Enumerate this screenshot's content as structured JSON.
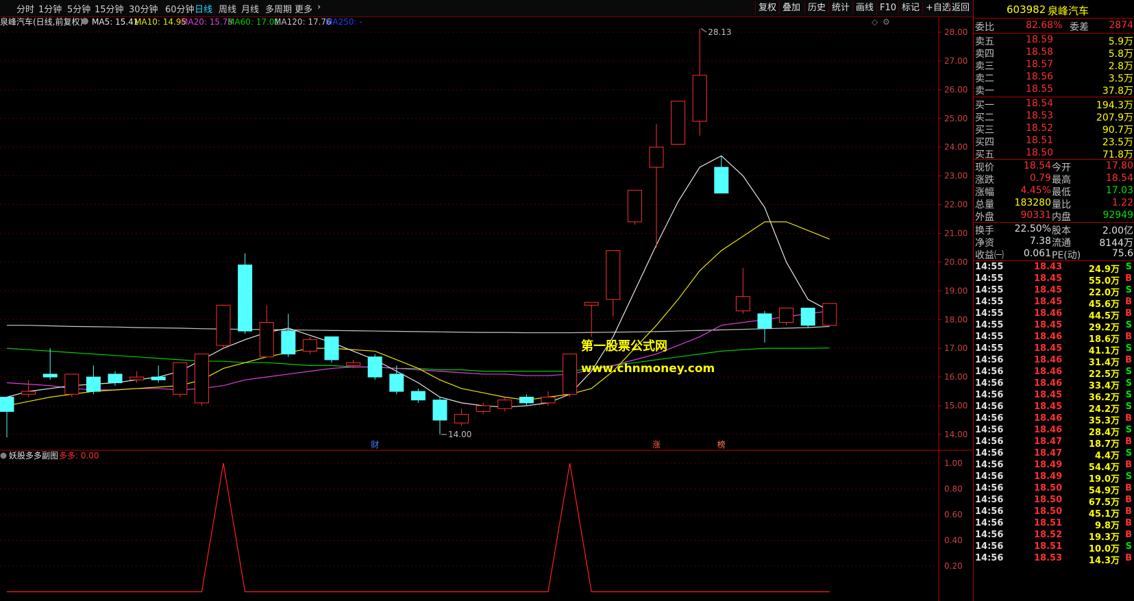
{
  "toolbar": {
    "period_tabs": [
      "分时",
      "1分钟",
      "5分钟",
      "15分钟",
      "30分钟",
      "60分钟",
      "日线",
      "周线",
      "月线",
      "多周期",
      "更多"
    ],
    "active_tab": "日线",
    "right_buttons": [
      "复权",
      "叠加",
      "历史",
      "统计",
      "画线",
      "F10",
      "标记",
      "+自选",
      "返回"
    ]
  },
  "main_chart": {
    "legend_title": "泉峰汽车(日线,前复权)",
    "ma_legend": [
      {
        "label": "MA5: 15.41",
        "color": "#e8e8e8"
      },
      {
        "label": "MA10: 14.95",
        "color": "#e8e800"
      },
      {
        "label": "MA20: 15.78",
        "color": "#e040e0"
      },
      {
        "label": "MA60: 17.01",
        "color": "#00d000"
      },
      {
        "label": "MA120: 17.76",
        "color": "#c8c8c8"
      },
      {
        "label": "MA250: -",
        "color": "#2040ff"
      }
    ],
    "price_ticks": [
      "28.00",
      "27.00",
      "26.00",
      "25.00",
      "24.00",
      "23.00",
      "22.00",
      "21.00",
      "20.00",
      "19.00",
      "18.00",
      "17.00",
      "16.00",
      "15.00",
      "14.00"
    ],
    "high_label": "28.13",
    "low_label": "14.00",
    "markers": [
      "财",
      "涨",
      "榜"
    ],
    "watermark": {
      "title": "第一股票公式网",
      "url": "www.chnmoney.com"
    }
  },
  "chart_data": [
    {
      "type": "candlestick",
      "y_range": [
        14.0,
        28.0
      ],
      "candles": [
        [
          15.3,
          14.8,
          15.2,
          13.9
        ],
        [
          15.4,
          15.5,
          15.9,
          15.3
        ],
        [
          16.1,
          16.0,
          17.0,
          15.9
        ],
        [
          15.4,
          16.1,
          16.1,
          15.3
        ],
        [
          16.0,
          15.5,
          16.4,
          15.4
        ],
        [
          16.1,
          15.8,
          16.2,
          15.7
        ],
        [
          15.9,
          16.0,
          16.2,
          15.8
        ],
        [
          16.0,
          15.9,
          16.4,
          15.8
        ],
        [
          15.4,
          16.5,
          16.5,
          15.3
        ],
        [
          15.1,
          16.8,
          16.8,
          15.0
        ],
        [
          17.1,
          18.5,
          18.5,
          17.0
        ],
        [
          19.9,
          17.6,
          20.3,
          17.5
        ],
        [
          16.7,
          17.9,
          18.5,
          16.7
        ],
        [
          17.6,
          16.8,
          18.2,
          16.7
        ],
        [
          16.9,
          17.3,
          17.4,
          16.8
        ],
        [
          17.4,
          16.6,
          17.4,
          16.5
        ],
        [
          16.4,
          16.5,
          16.6,
          16.3
        ],
        [
          16.7,
          16.0,
          16.8,
          15.9
        ],
        [
          16.1,
          15.5,
          16.4,
          15.4
        ],
        [
          15.5,
          15.2,
          15.6,
          15.1
        ],
        [
          15.2,
          14.5,
          15.3,
          14.0
        ],
        [
          14.4,
          14.7,
          14.9,
          14.3
        ],
        [
          14.8,
          15.0,
          15.1,
          14.7
        ],
        [
          14.9,
          15.2,
          15.3,
          14.8
        ],
        [
          15.3,
          15.1,
          15.4,
          15.0
        ],
        [
          15.1,
          15.3,
          15.5,
          15.0
        ],
        [
          15.4,
          16.8,
          16.8,
          15.3
        ],
        [
          18.5,
          18.6,
          18.6,
          17.4
        ],
        [
          18.7,
          20.4,
          20.4,
          18.1
        ],
        [
          21.4,
          22.5,
          22.5,
          21.3
        ],
        [
          23.3,
          24.0,
          24.8,
          20.5
        ],
        [
          24.1,
          25.6,
          25.6,
          24.1
        ],
        [
          24.9,
          26.5,
          28.13,
          24.4
        ],
        [
          23.3,
          22.4,
          23.7,
          22.4
        ],
        [
          18.3,
          18.8,
          19.8,
          18.2
        ],
        [
          18.2,
          17.7,
          18.3,
          17.2
        ],
        [
          17.9,
          18.4,
          18.4,
          17.8
        ],
        [
          18.4,
          17.8,
          18.4,
          17.7
        ],
        [
          17.8,
          18.56,
          18.56,
          17.8
        ]
      ],
      "ma5": [
        15.3,
        15.5,
        15.6,
        15.7,
        15.75,
        15.8,
        15.9,
        16.0,
        16.2,
        16.6,
        17.0,
        17.3,
        17.55,
        17.7,
        17.45,
        17.2,
        16.9,
        16.6,
        16.2,
        15.8,
        15.3,
        15.1,
        15.0,
        14.95,
        15.0,
        15.1,
        15.4,
        16.2,
        17.4,
        19.0,
        20.6,
        22.1,
        23.3,
        23.7,
        23.0,
        21.9,
        20.0,
        18.7,
        18.3
      ],
      "ma10": [
        15.0,
        15.15,
        15.3,
        15.4,
        15.5,
        15.55,
        15.6,
        15.65,
        15.7,
        15.9,
        16.3,
        16.5,
        16.7,
        16.85,
        17.0,
        17.0,
        16.95,
        16.9,
        16.6,
        16.3,
        15.9,
        15.6,
        15.45,
        15.3,
        15.2,
        15.3,
        15.4,
        15.6,
        16.2,
        17.0,
        17.8,
        18.7,
        19.7,
        20.4,
        20.9,
        21.4,
        21.4,
        21.1,
        20.8
      ],
      "ma20": [
        15.8,
        15.75,
        15.7,
        15.6,
        15.55,
        15.55,
        15.6,
        15.6,
        15.55,
        15.6,
        15.7,
        15.9,
        16.0,
        16.1,
        16.2,
        16.3,
        16.35,
        16.35,
        16.3,
        16.25,
        16.2,
        16.15,
        16.1,
        16.1,
        16.05,
        16.05,
        16.1,
        16.25,
        16.4,
        16.6,
        16.8,
        17.1,
        17.4,
        17.8,
        17.9,
        18.0,
        18.1,
        18.2,
        18.3
      ],
      "ma60": [
        17.0,
        16.95,
        16.9,
        16.85,
        16.8,
        16.75,
        16.7,
        16.65,
        16.6,
        16.55,
        16.55,
        16.5,
        16.5,
        16.45,
        16.4,
        16.4,
        16.35,
        16.35,
        16.3,
        16.3,
        16.25,
        16.25,
        16.2,
        16.2,
        16.2,
        16.2,
        16.2,
        16.3,
        16.4,
        16.5,
        16.6,
        16.7,
        16.8,
        16.9,
        16.95,
        17.0,
        17.0,
        17.0,
        17.01
      ],
      "ma120": [
        17.8,
        17.8,
        17.78,
        17.76,
        17.75,
        17.74,
        17.72,
        17.71,
        17.7,
        17.68,
        17.67,
        17.66,
        17.65,
        17.64,
        17.63,
        17.62,
        17.61,
        17.6,
        17.59,
        17.58,
        17.57,
        17.56,
        17.55,
        17.55,
        17.54,
        17.54,
        17.54,
        17.55,
        17.56,
        17.57,
        17.58,
        17.6,
        17.62,
        17.64,
        17.66,
        17.68,
        17.7,
        17.72,
        17.76
      ]
    },
    {
      "type": "line",
      "title": "妖股多多副图",
      "series_label": "多多: 0.00",
      "y_ticks": [
        "1.00",
        "0.80",
        "0.60",
        "0.40",
        "0.20"
      ],
      "y_range": [
        0.2,
        1.0
      ],
      "values": [
        0,
        0,
        0,
        0,
        0,
        0,
        0,
        0,
        0,
        0,
        1,
        0,
        0,
        0,
        0,
        0,
        0,
        0,
        0,
        0,
        0,
        0,
        0,
        0,
        0,
        0,
        1,
        0,
        0,
        0,
        0,
        0,
        0,
        0,
        0,
        0,
        0,
        0,
        0
      ]
    }
  ],
  "quote": {
    "code": "603982",
    "name": "泉峰汽车",
    "weibi_label": "委比",
    "weibi_value": "82.68%",
    "weicha_label": "委差",
    "weicha_value": "2874",
    "sell": [
      {
        "label": "卖五",
        "price": "18.59",
        "vol": "5.9万"
      },
      {
        "label": "卖四",
        "price": "18.58",
        "vol": "5.8万"
      },
      {
        "label": "卖三",
        "price": "18.57",
        "vol": "2.8万"
      },
      {
        "label": "卖二",
        "price": "18.56",
        "vol": "3.5万"
      },
      {
        "label": "卖一",
        "price": "18.55",
        "vol": "37.8万"
      }
    ],
    "buy": [
      {
        "label": "买一",
        "price": "18.54",
        "vol": "194.3万"
      },
      {
        "label": "买二",
        "price": "18.53",
        "vol": "207.9万"
      },
      {
        "label": "买三",
        "price": "18.52",
        "vol": "90.7万"
      },
      {
        "label": "买四",
        "price": "18.51",
        "vol": "23.5万"
      },
      {
        "label": "买五",
        "price": "18.50",
        "vol": "71.8万"
      }
    ],
    "stats": [
      {
        "l1": "现价",
        "v1": "18.54",
        "c1": "#ff3030",
        "l2": "今开",
        "v2": "17.80",
        "c2": "#ff3030"
      },
      {
        "l1": "涨跌",
        "v1": "0.79",
        "c1": "#ff3030",
        "l2": "最高",
        "v2": "18.54",
        "c2": "#ff3030"
      },
      {
        "l1": "涨幅",
        "v1": "4.45%",
        "c1": "#ff3030",
        "l2": "最低",
        "v2": "17.03",
        "c2": "#00e000"
      },
      {
        "l1": "总量",
        "v1": "183280",
        "c1": "#ffff00",
        "l2": "量比",
        "v2": "1.22",
        "c2": "#ff3030"
      },
      {
        "l1": "外盘",
        "v1": "90331",
        "c1": "#ff3030",
        "l2": "内盘",
        "v2": "92949",
        "c2": "#00e000"
      }
    ],
    "fin": [
      {
        "l1": "换手",
        "v1": "22.50%",
        "l2": "股本",
        "v2": "2.00亿"
      },
      {
        "l1": "净资",
        "v1": "7.38",
        "l2": "流通",
        "v2": "8144万"
      },
      {
        "l1": "收益㈠",
        "v1": "0.061",
        "l2": "PE(动)",
        "v2": "75.6"
      }
    ]
  },
  "ticks": [
    {
      "t": "14:55",
      "p": "18.43",
      "v": "24.9万",
      "d": "S"
    },
    {
      "t": "14:55",
      "p": "18.45",
      "v": "55.0万",
      "d": "B"
    },
    {
      "t": "14:55",
      "p": "18.45",
      "v": "22.0万",
      "d": "S"
    },
    {
      "t": "14:55",
      "p": "18.45",
      "v": "45.6万",
      "d": "B"
    },
    {
      "t": "14:55",
      "p": "18.46",
      "v": "44.5万",
      "d": "B"
    },
    {
      "t": "14:55",
      "p": "18.45",
      "v": "29.2万",
      "d": "S"
    },
    {
      "t": "14:55",
      "p": "18.46",
      "v": "18.6万",
      "d": "B"
    },
    {
      "t": "14:55",
      "p": "18.45",
      "v": "41.1万",
      "d": "S"
    },
    {
      "t": "14:56",
      "p": "18.46",
      "v": "31.4万",
      "d": "B"
    },
    {
      "t": "14:56",
      "p": "18.46",
      "v": "22.5万",
      "d": "S"
    },
    {
      "t": "14:56",
      "p": "18.46",
      "v": "33.4万",
      "d": "S"
    },
    {
      "t": "14:56",
      "p": "18.45",
      "v": "36.2万",
      "d": "S"
    },
    {
      "t": "14:56",
      "p": "18.45",
      "v": "24.2万",
      "d": "S"
    },
    {
      "t": "14:56",
      "p": "18.46",
      "v": "35.3万",
      "d": "B"
    },
    {
      "t": "14:56",
      "p": "18.46",
      "v": "28.4万",
      "d": "S"
    },
    {
      "t": "14:56",
      "p": "18.47",
      "v": "18.7万",
      "d": "B"
    },
    {
      "t": "14:56",
      "p": "18.47",
      "v": "4.4万",
      "d": "S"
    },
    {
      "t": "14:56",
      "p": "18.49",
      "v": "54.4万",
      "d": "B"
    },
    {
      "t": "14:56",
      "p": "18.49",
      "v": "19.0万",
      "d": "S"
    },
    {
      "t": "14:56",
      "p": "18.50",
      "v": "54.9万",
      "d": "B"
    },
    {
      "t": "14:56",
      "p": "18.50",
      "v": "67.5万",
      "d": "B"
    },
    {
      "t": "14:56",
      "p": "18.50",
      "v": "45.1万",
      "d": "B"
    },
    {
      "t": "14:56",
      "p": "18.51",
      "v": "9.8万",
      "d": "B"
    },
    {
      "t": "14:56",
      "p": "18.52",
      "v": "19.3万",
      "d": "B"
    },
    {
      "t": "14:56",
      "p": "18.51",
      "v": "10.0万",
      "d": "S"
    },
    {
      "t": "14:56",
      "p": "18.53",
      "v": "14.3万",
      "d": "B"
    }
  ],
  "colors": {
    "up": "#ff3030",
    "down": "#54ffff",
    "grid": "#5a0000",
    "axis": "#c00000"
  }
}
